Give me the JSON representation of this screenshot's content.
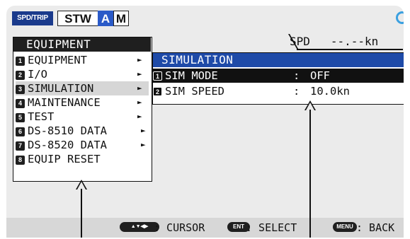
{
  "topbar": {
    "spd_trip": "SPD/TRIP",
    "stw": "STW",
    "mode_a": "A",
    "mode_m": "M"
  },
  "speed": {
    "label": "SPD",
    "value": "--.--kn"
  },
  "menu1": {
    "title": "EQUIPMENT",
    "items": [
      {
        "num": "1",
        "label": "EQUIPMENT",
        "arrow": "►"
      },
      {
        "num": "2",
        "label": "I/O",
        "arrow": "►"
      },
      {
        "num": "3",
        "label": "SIMULATION",
        "arrow": "►"
      },
      {
        "num": "4",
        "label": "MAINTENANCE",
        "arrow": "►"
      },
      {
        "num": "5",
        "label": "TEST",
        "arrow": "►"
      },
      {
        "num": "6",
        "label": "DS-8510 DATA",
        "arrow": "►"
      },
      {
        "num": "7",
        "label": "DS-8520 DATA",
        "arrow": "►"
      },
      {
        "num": "8",
        "label": "EQUIP RESET",
        "arrow": ""
      }
    ]
  },
  "menu2": {
    "title": "SIMULATION",
    "items": [
      {
        "num": "1",
        "label": "SIM MODE",
        "sep": ":",
        "value": "OFF"
      },
      {
        "num": "2",
        "label": "SIM SPEED",
        "sep": ":",
        "value": "10.0kn"
      }
    ]
  },
  "bottom": {
    "cursor_key": "▲▼◀▶",
    "cursor_label": ": CURSOR",
    "select_key": "ENT",
    "select_label": ": SELECT",
    "back_key": "MENU",
    "back_label": ": BACK"
  }
}
